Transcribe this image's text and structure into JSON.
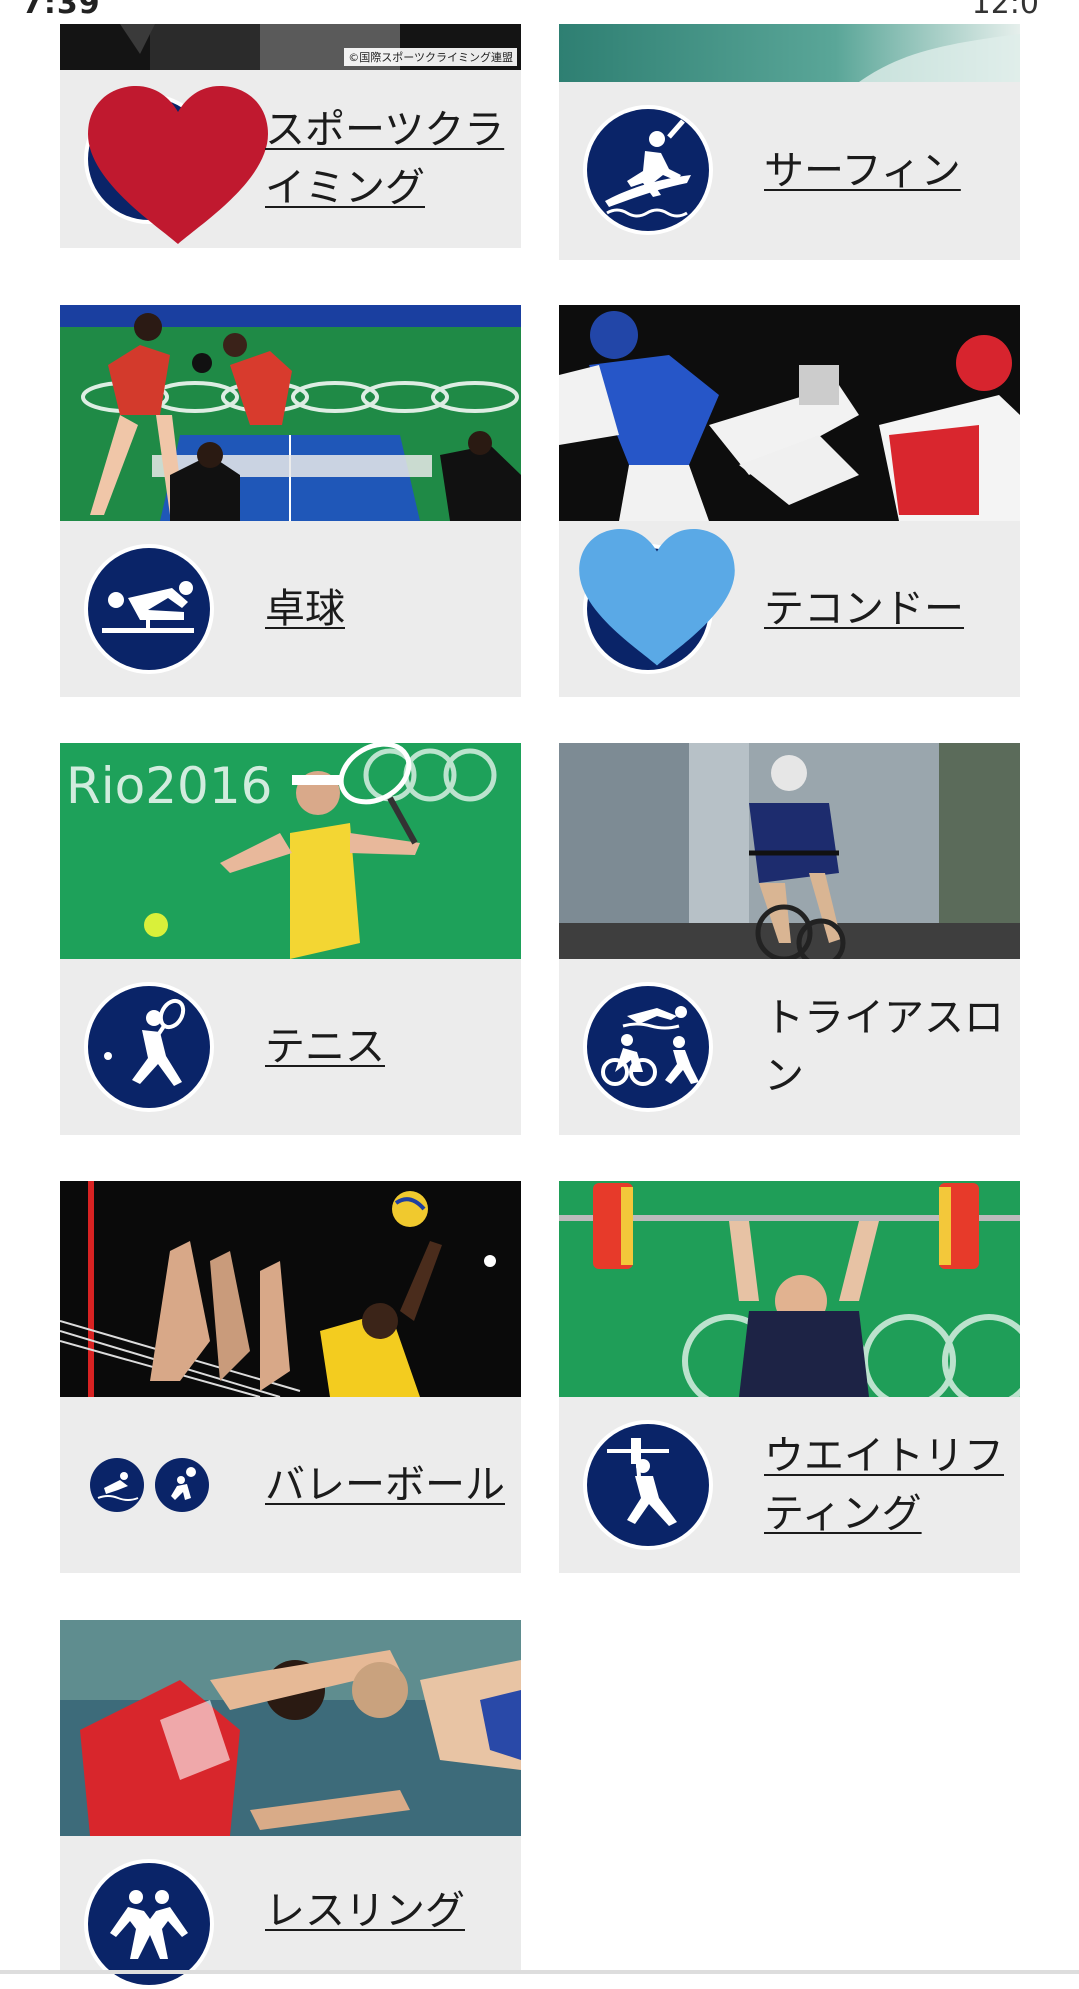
{
  "status_bar": {
    "time": "7:39",
    "right_text": "12:0"
  },
  "sports": [
    {
      "label": "スポーツクライミング",
      "linked": true,
      "photo_credit": "©国際スポーツクライミング連盟",
      "icon": "sport-climbing-pictogram"
    },
    {
      "label": "サーフィン",
      "linked": true,
      "icon": "surfing-pictogram"
    },
    {
      "label": "卓球",
      "linked": true,
      "icon": "table-tennis-pictogram"
    },
    {
      "label": "テコンドー",
      "linked": true,
      "icon": "taekwondo-pictogram"
    },
    {
      "label": "テニス",
      "linked": true,
      "icon": "tennis-pictogram"
    },
    {
      "label": "トライアスロン",
      "linked": false,
      "icon": "triathlon-pictogram"
    },
    {
      "label": "バレーボール",
      "linked": true,
      "icon": "volleyball-pictogram"
    },
    {
      "label": "ウエイトリフティング",
      "linked": true,
      "icon": "weightlifting-pictogram"
    },
    {
      "label": "レスリング",
      "linked": true,
      "icon": "wrestling-pictogram"
    }
  ],
  "colors": {
    "card_bg": "#ececec",
    "pictogram_navy": "#0a2468",
    "heart_red": "#c0192f",
    "heart_blue": "#5aa9e6"
  }
}
